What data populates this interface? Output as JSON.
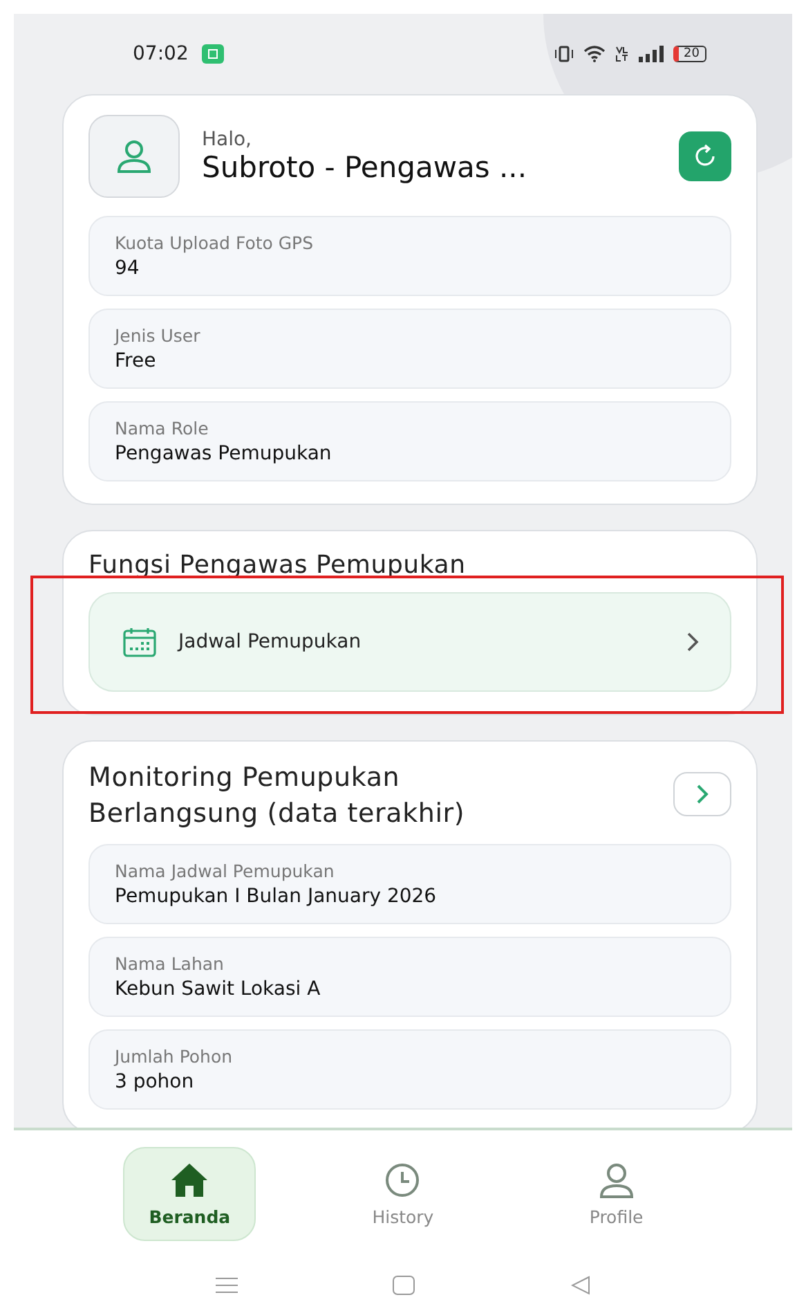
{
  "status_bar": {
    "time": "07:02",
    "battery": "20"
  },
  "profile_card": {
    "greeting": "Halo,",
    "name": "Subroto - Pengawas ...",
    "fields": [
      {
        "label": "Kuota Upload Foto GPS",
        "value": "94"
      },
      {
        "label": "Jenis User",
        "value": "Free"
      },
      {
        "label": "Nama Role",
        "value": "Pengawas Pemupukan"
      }
    ]
  },
  "functions_card": {
    "title": "Fungsi Pengawas Pemupukan",
    "items": [
      {
        "label": "Jadwal Pemupukan",
        "highlighted": true
      }
    ]
  },
  "monitoring_card": {
    "title": "Monitoring Pemupukan Berlangsung (data terakhir)",
    "fields": [
      {
        "label": "Nama Jadwal Pemupukan",
        "value": "Pemupukan I Bulan January 2026"
      },
      {
        "label": "Nama Lahan",
        "value": "Kebun Sawit Lokasi A"
      },
      {
        "label": "Jumlah Pohon",
        "value": "3 pohon"
      }
    ]
  },
  "bottom_nav": [
    {
      "label": "Beranda",
      "kind": "home",
      "selected": true
    },
    {
      "label": "History",
      "kind": "history",
      "selected": false
    },
    {
      "label": "Profile",
      "kind": "profile",
      "selected": false
    }
  ]
}
